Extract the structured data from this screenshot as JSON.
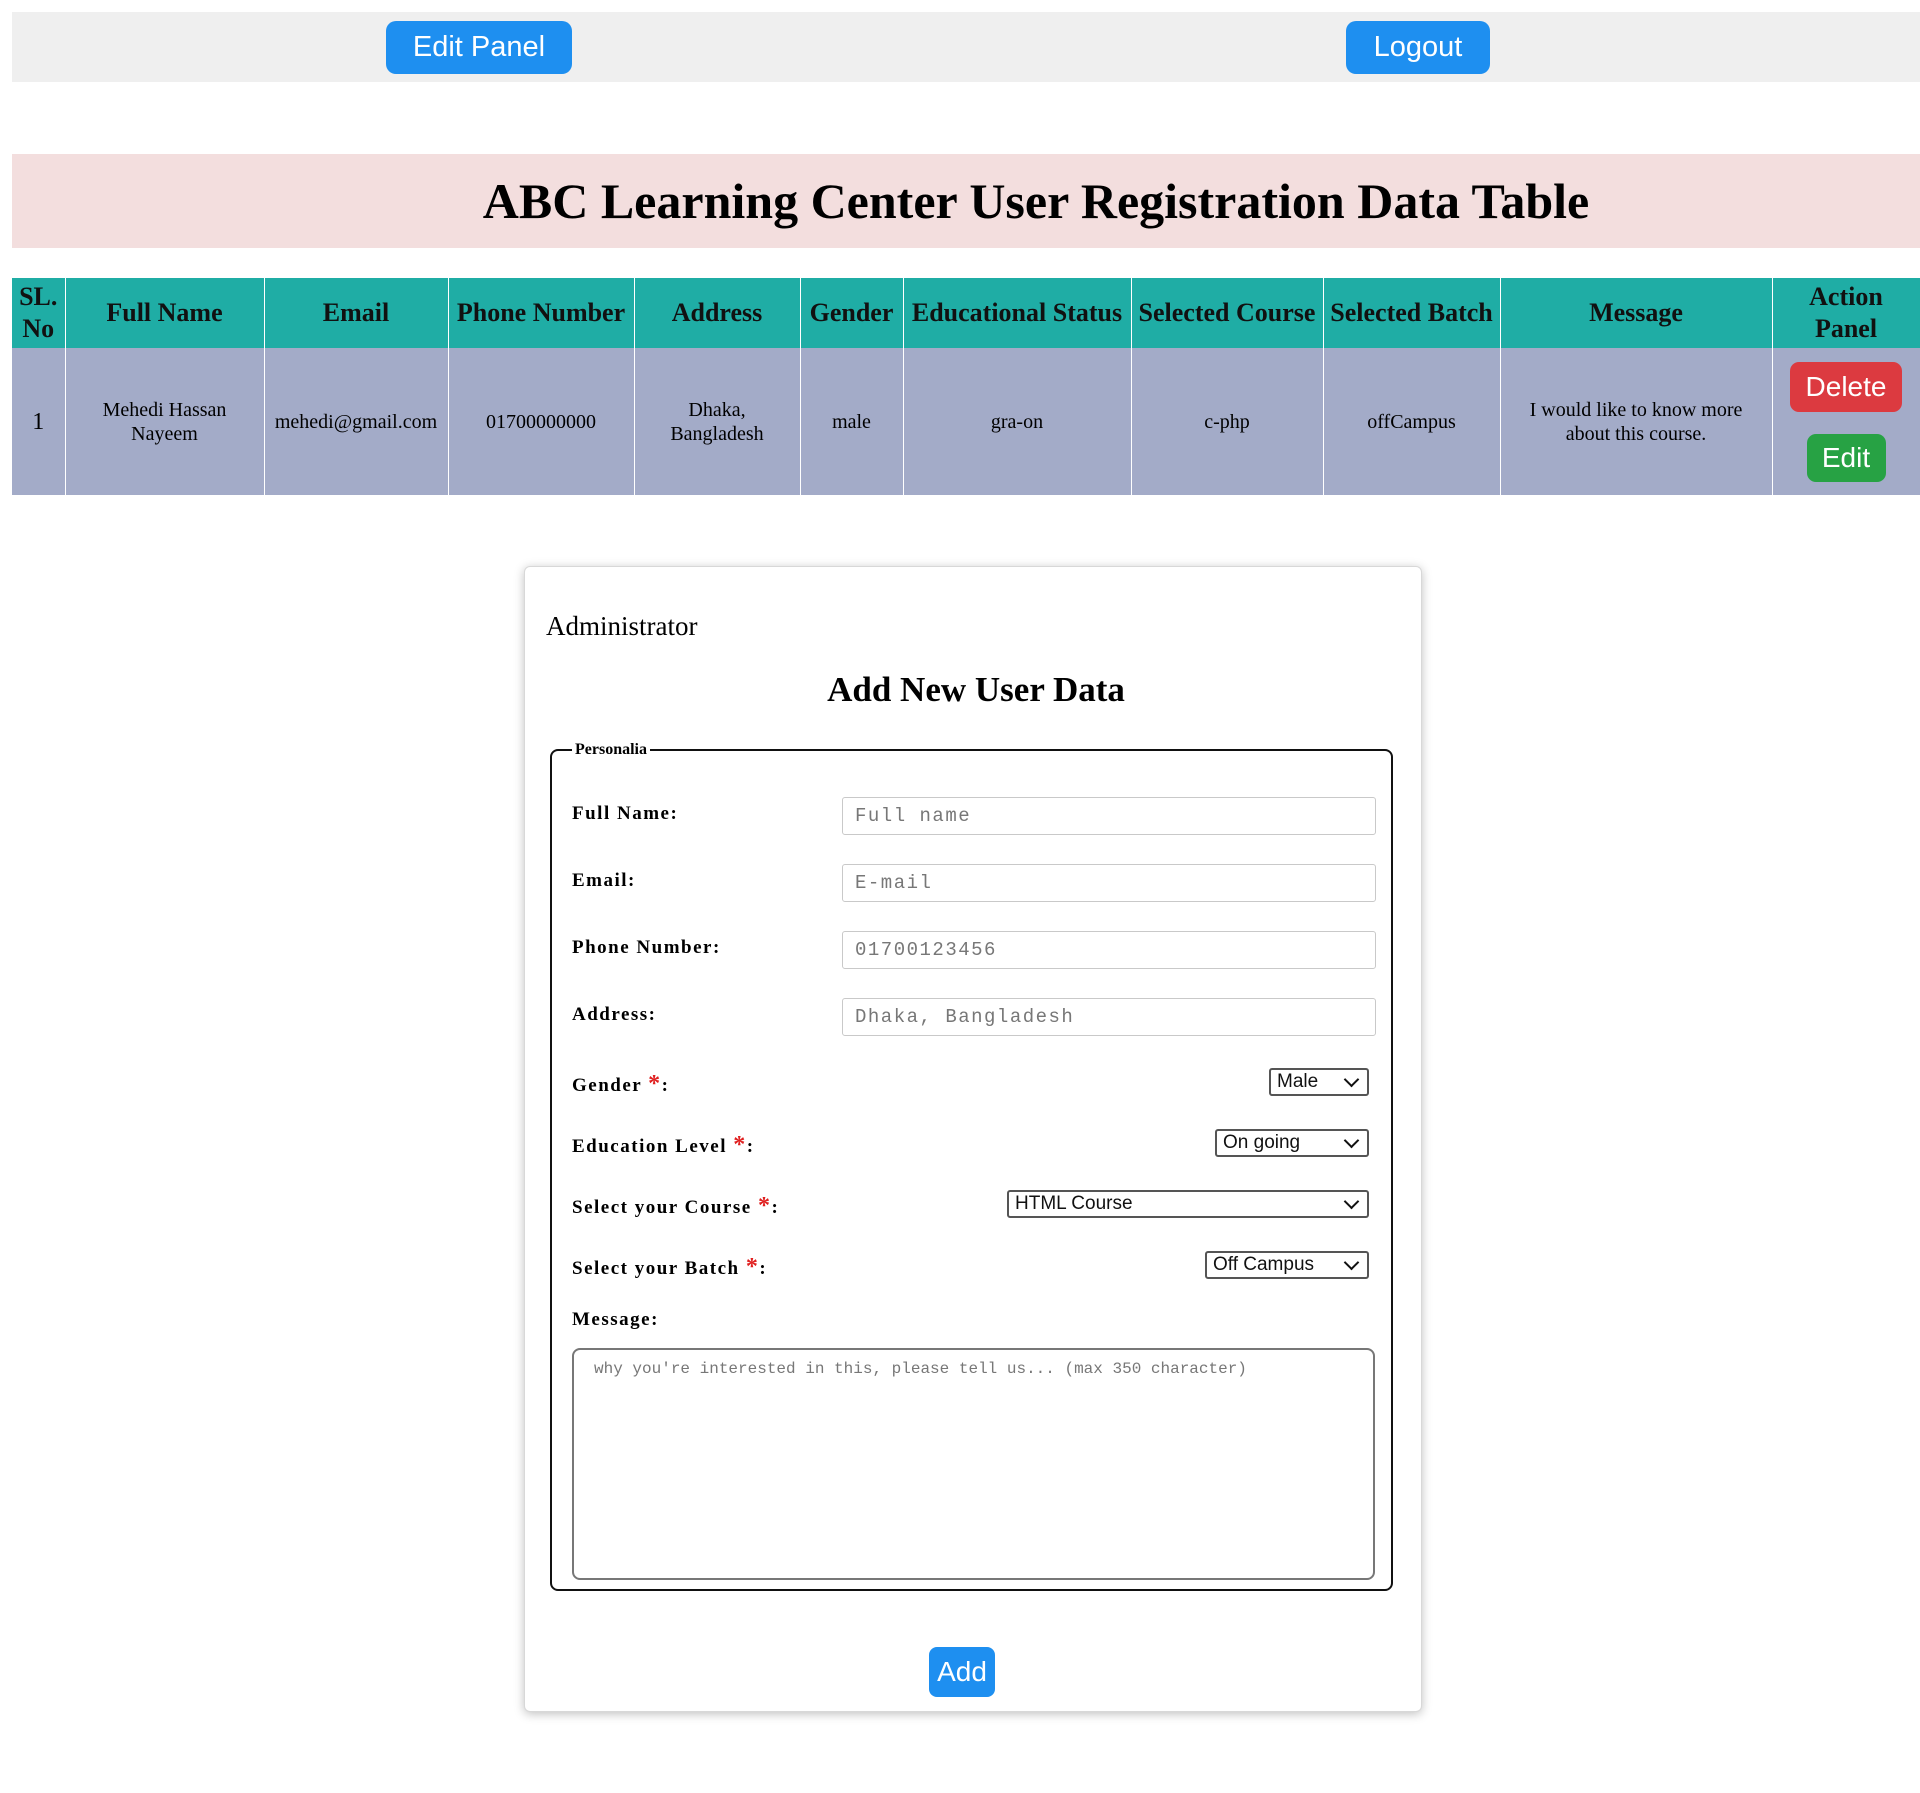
{
  "header": {
    "edit_panel_label": "Edit Panel",
    "logout_label": "Logout"
  },
  "page_title": "ABC Learning Center User Registration Data Table",
  "table": {
    "headers": [
      "SL. No",
      "Full Name",
      "Email",
      "Phone Number",
      "Address",
      "Gender",
      "Educational Status",
      "Selected Course",
      "Selected Batch",
      "Message",
      "Action Panel"
    ],
    "rows": [
      {
        "sl": "1",
        "full_name": "Mehedi Hassan Nayeem",
        "email": "mehedi@gmail.com",
        "phone": "01700000000",
        "address": "Dhaka, Bangladesh",
        "gender": "male",
        "education": "gra-on",
        "course": "c-php",
        "batch": "offCampus",
        "message": "I would like to know more about this course.",
        "delete_label": "Delete",
        "edit_label": "Edit"
      }
    ]
  },
  "form": {
    "admin_label": "Administrator",
    "heading": "Add New User Data",
    "legend": "Personalia",
    "full_name": {
      "label": "Full Name:",
      "placeholder": "Full name"
    },
    "email": {
      "label": "Email:",
      "placeholder": "E-mail"
    },
    "phone": {
      "label": "Phone Number:",
      "placeholder": "01700123456"
    },
    "address": {
      "label": "Address:",
      "placeholder": "Dhaka, Bangladesh"
    },
    "gender": {
      "label": "Gender ",
      "value": "Male"
    },
    "education": {
      "label": "Education Level ",
      "value": "On going"
    },
    "course": {
      "label": "Select your Course ",
      "value": "HTML Course"
    },
    "batch": {
      "label": "Select your Batch ",
      "value": "Off Campus"
    },
    "required_mark": "*",
    "colon": ":",
    "message": {
      "label": "Message:",
      "placeholder": "why you're interested in this, please tell us... (max 350 character)"
    },
    "add_label": "Add"
  },
  "colors": {
    "primary_blue": "#1e8ff0",
    "table_header": "#1fada5",
    "table_row": "#a3abc8",
    "title_banner": "#f3dede",
    "delete_red": "#dc3a40",
    "edit_green": "#27a244"
  }
}
